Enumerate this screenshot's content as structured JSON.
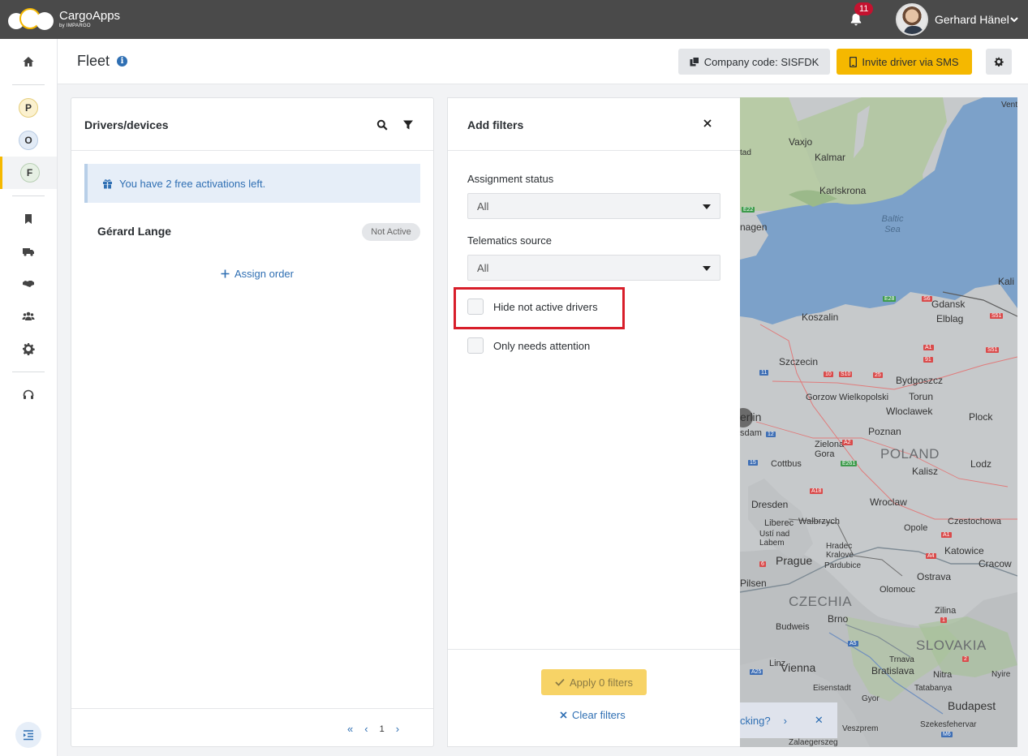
{
  "topbar": {
    "app_name": "CargoApps",
    "app_sub": "by IMPARGO",
    "notification_count": "11",
    "user_name": "Gerhard Hänel"
  },
  "sidebar": {
    "items": [
      {
        "name": "home",
        "icon": "home-icon"
      },
      {
        "name": "P",
        "label": "P",
        "color": "#f5e9c0"
      },
      {
        "name": "O",
        "label": "O",
        "color": "#dde8f3"
      },
      {
        "name": "F",
        "label": "F",
        "color": "#e3efe2"
      },
      {
        "name": "orders",
        "icon": "bookmark-icon"
      },
      {
        "name": "fleet",
        "icon": "truck-icon"
      },
      {
        "name": "partners",
        "icon": "handshake-icon"
      },
      {
        "name": "team",
        "icon": "users-icon"
      },
      {
        "name": "settings",
        "icon": "gear-icon"
      },
      {
        "name": "support",
        "icon": "headset-icon"
      }
    ]
  },
  "header": {
    "title": "Fleet",
    "company_code_label": "Company code: SISFDK",
    "invite_label": "Invite driver via SMS"
  },
  "drivers": {
    "title": "Drivers/devices",
    "notice": "You have 2 free activations left.",
    "driver_name": "Gérard Lange",
    "driver_status": "Not Active",
    "assign_label": "Assign order",
    "page": "1"
  },
  "filters": {
    "title": "Add filters",
    "assignment_label": "Assignment status",
    "assignment_value": "All",
    "telematics_label": "Telematics source",
    "telematics_value": "All",
    "hide_inactive_label": "Hide not active drivers",
    "attention_label": "Only needs attention",
    "apply_label": "Apply 0 filters",
    "clear_label": "Clear filters"
  },
  "map": {
    "cities": [
      "Vaxjo",
      "Kalmar",
      "Karlskrona",
      "nagen",
      "Koszalin",
      "Gdansk",
      "Elblag",
      "Szczecin",
      "Bydgoszcz",
      "Gorzow Wielkopolski",
      "Torun",
      "Wloclawek",
      "Plock",
      "erlin",
      "sdam",
      "Poznan",
      "Zielona Gora",
      "Cottbus",
      "Kalisz",
      "Lodz",
      "Dresden",
      "Wroclaw",
      "Liberec",
      "Walbrzych",
      "Ustí nad Labem",
      "Opole",
      "Czestochowa",
      "Hradec Kralove",
      "Pardubice",
      "Prague",
      "Katowice",
      "Cracow",
      "Ostrava",
      "Pilsen",
      "Olomouc",
      "Brno",
      "Budweis",
      "Zilina",
      "Linz",
      "Vienna",
      "Bratislava",
      "Trnava",
      "Nitra",
      "Eisenstadt",
      "Budapest",
      "Gyor",
      "Szekesfehervar",
      "Veszprem",
      "Zalaegerszeg",
      "Tatabanya",
      "Kali",
      "Vent",
      "tad",
      "Nyire"
    ],
    "countries": [
      "POLAND",
      "CZECHIA",
      "SLOVAKIA"
    ],
    "sea": "Baltic Sea",
    "toast_text": "cking?"
  }
}
